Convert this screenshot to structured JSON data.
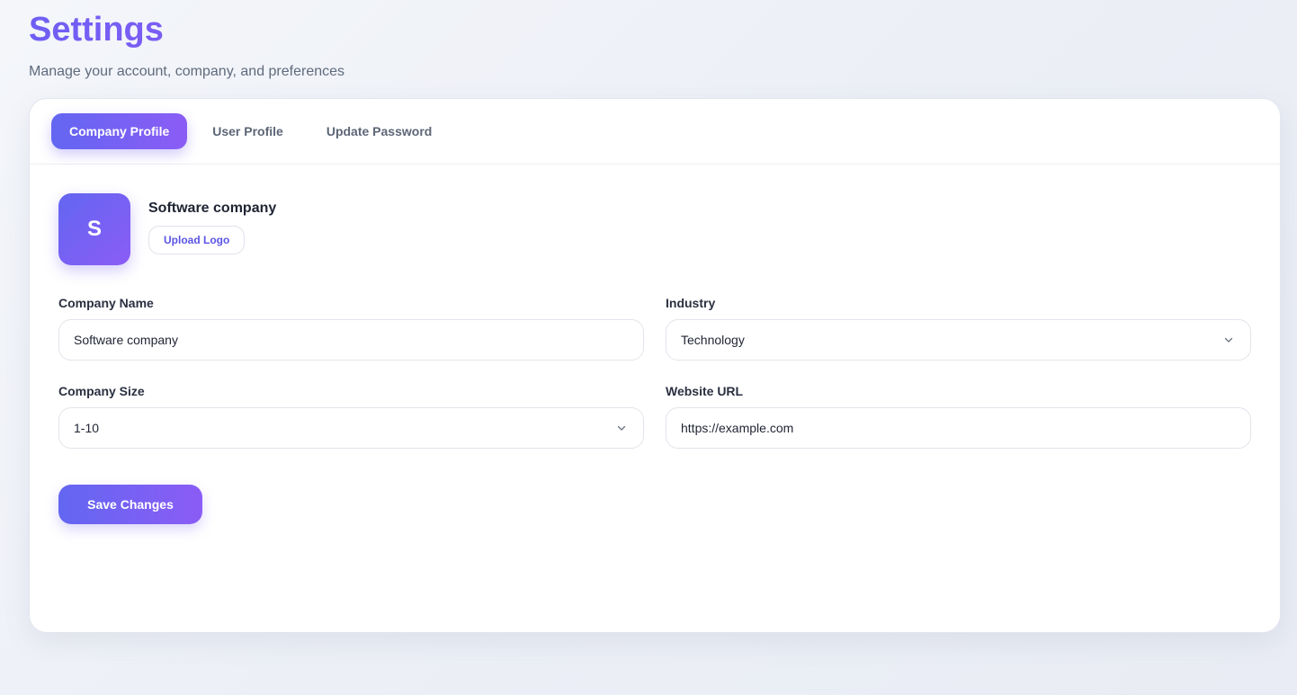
{
  "header": {
    "title": "Settings",
    "subtitle": "Manage your account, company, and preferences"
  },
  "tabs": [
    {
      "label": "Company Profile",
      "active": true
    },
    {
      "label": "User Profile",
      "active": false
    },
    {
      "label": "Update Password",
      "active": false
    }
  ],
  "profile": {
    "logo_letter": "S",
    "company_name": "Software company",
    "upload_label": "Upload Logo"
  },
  "form": {
    "company_name": {
      "label": "Company Name",
      "value": "Software company"
    },
    "industry": {
      "label": "Industry",
      "value": "Technology"
    },
    "company_size": {
      "label": "Company Size",
      "value": "1-10"
    },
    "website_url": {
      "label": "Website URL",
      "value": "https://example.com"
    }
  },
  "actions": {
    "save_label": "Save Changes"
  },
  "icons": {
    "select_chevron": "chevron-down-icon"
  },
  "colors": {
    "accent_start": "#6366f1",
    "accent_end": "#8b5cf6",
    "subtitle": "#5f6b7d"
  }
}
